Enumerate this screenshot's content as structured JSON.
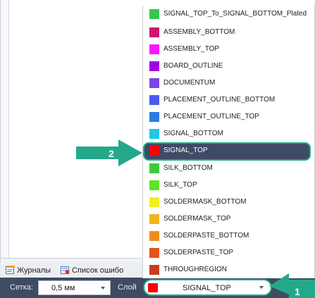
{
  "tabs": [
    {
      "label": "Журналы",
      "icon": "journal-icon"
    },
    {
      "label": "Список ошибо",
      "icon": "error-list-icon"
    }
  ],
  "status_bar": {
    "grid_label": "Сетка:",
    "grid_value": "0,5 мм",
    "layer_label": "Слой",
    "layer_value": "SIGNAL_TOP",
    "layer_color": "#ff0000"
  },
  "layers": [
    {
      "name": "SIGNAL_TOP_To_SIGNAL_BOTTOM_Plated",
      "color": "#32c850"
    },
    {
      "name": "ASSEMBLY_BOTTOM",
      "color": "#d2146e"
    },
    {
      "name": "ASSEMBLY_TOP",
      "color": "#ff14ff"
    },
    {
      "name": "BOARD_OUTLINE",
      "color": "#a000e6"
    },
    {
      "name": "DOCUMENTUM",
      "color": "#7a46e6"
    },
    {
      "name": "PLACEMENT_OUTLINE_BOTTOM",
      "color": "#4a5af0"
    },
    {
      "name": "PLACEMENT_OUTLINE_TOP",
      "color": "#2c7ae6"
    },
    {
      "name": "SIGNAL_BOTTOM",
      "color": "#1ec8e6"
    },
    {
      "name": "SIGNAL_TOP",
      "color": "#ff0000",
      "selected": true
    },
    {
      "name": "SILK_BOTTOM",
      "color": "#40c83c"
    },
    {
      "name": "SILK_TOP",
      "color": "#5ae61e"
    },
    {
      "name": "SOLDERMASK_BOTTOM",
      "color": "#f0f01e"
    },
    {
      "name": "SOLDERMASK_TOP",
      "color": "#f0b41e"
    },
    {
      "name": "SOLDERPASTE_BOTTOM",
      "color": "#f08c1e"
    },
    {
      "name": "SOLDERPASTE_TOP",
      "color": "#e6501e"
    },
    {
      "name": "THROUGHREGION",
      "color": "#c83c1e"
    }
  ],
  "callouts": {
    "one": "1",
    "two": "2"
  },
  "colors": {
    "accent": "#23a98a",
    "status_bar": "#3e4b61",
    "selected_item": "#3e4b66"
  }
}
